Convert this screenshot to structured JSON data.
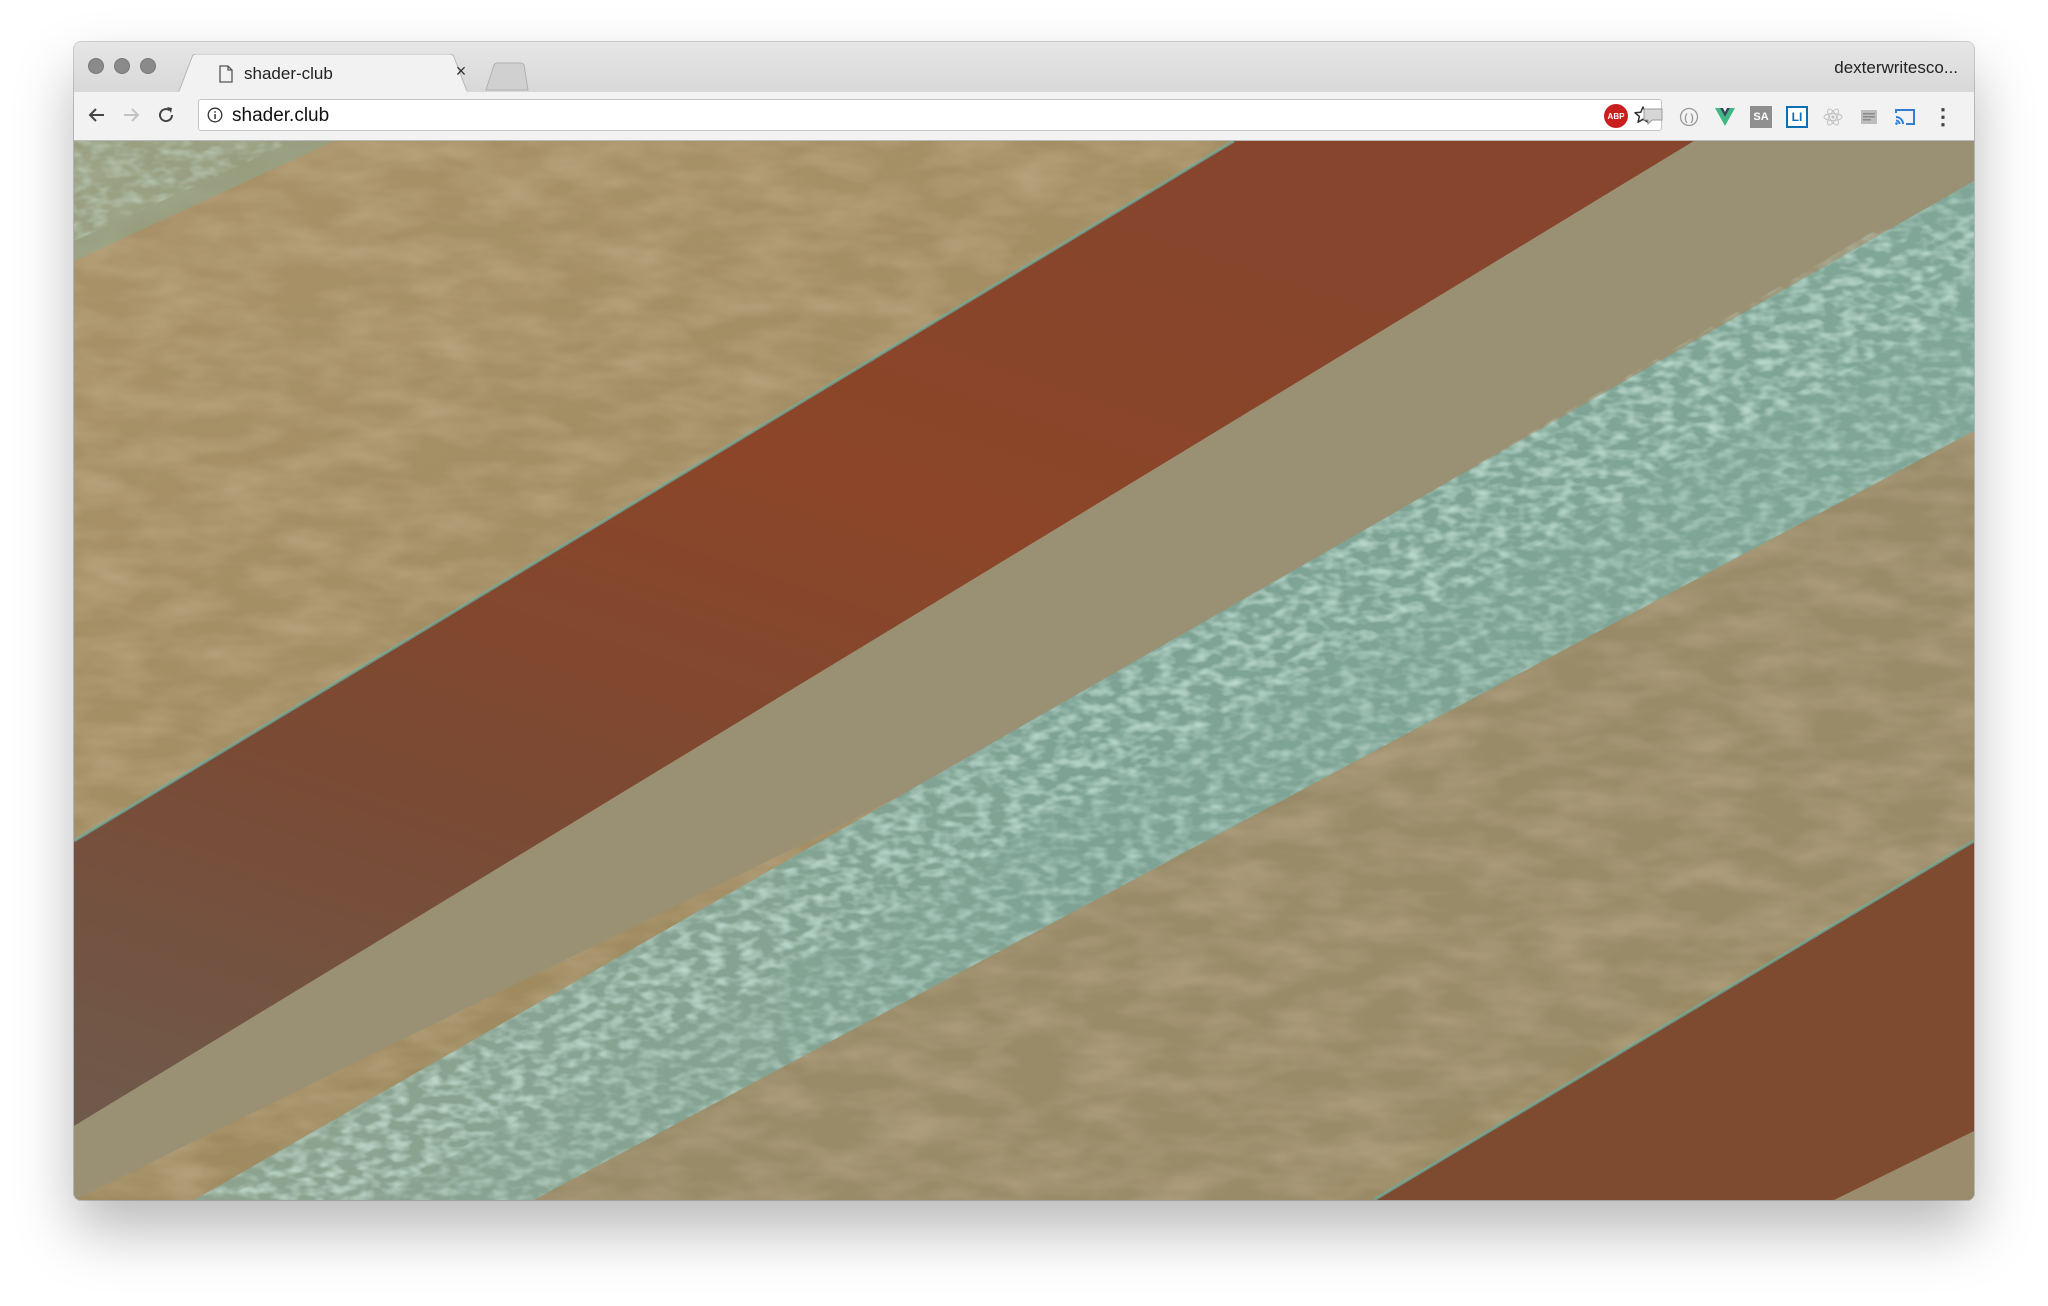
{
  "browser": {
    "tab": {
      "title": "shader-club",
      "close_glyph": "×",
      "favicon": "page-icon"
    },
    "profile_name": "dexterwritesco...",
    "address_bar": {
      "url": "shader.club",
      "left_icon": "info-icon",
      "right_icon": "star-icon"
    },
    "nav": {
      "back_icon": "arrow-left-icon",
      "forward_icon": "arrow-right-icon",
      "reload_icon": "reload-icon"
    },
    "extensions": [
      {
        "name": "adblock-plus-icon",
        "label": "ABP",
        "color": "#c91f1f"
      },
      {
        "name": "speech-bubble-icon",
        "label": "",
        "color": "#b9b9b9"
      },
      {
        "name": "circle-brackets-icon",
        "label": "",
        "color": "#a5a5a5"
      },
      {
        "name": "vue-devtools-icon",
        "label": "",
        "color": "#41b883"
      },
      {
        "name": "sa-icon",
        "label": "SA",
        "color": "#8f8f8f"
      },
      {
        "name": "li-icon",
        "label": "LI",
        "color": "#0b6fb5"
      },
      {
        "name": "react-icon",
        "label": "",
        "color": "#bcbcbc"
      },
      {
        "name": "reader-icon",
        "label": "",
        "color": "#9a9a9a"
      },
      {
        "name": "cast-icon",
        "label": "",
        "color": "#2f7fd6"
      },
      {
        "name": "menu-dots-icon",
        "label": "⋮",
        "color": "#444444"
      }
    ]
  },
  "canvas": {
    "name": "shader-canvas",
    "colors": {
      "sand": "#a08d63",
      "rust": "#8a4a2c",
      "teal": "#7fc4b0",
      "dune": "#8c8f76"
    }
  }
}
